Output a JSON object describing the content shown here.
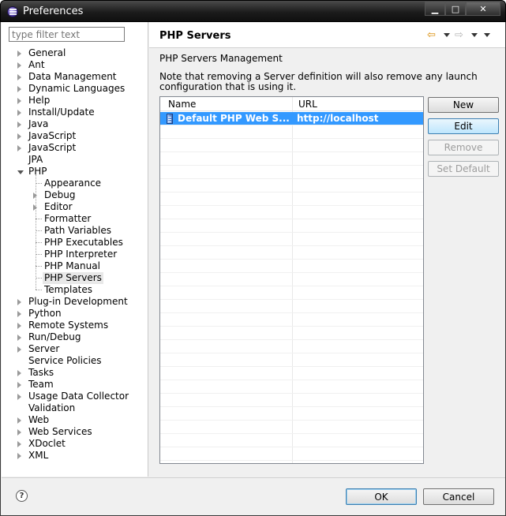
{
  "window": {
    "title": "Preferences",
    "controls": {
      "minimize": "▁",
      "maximize": "□",
      "close": "✕"
    }
  },
  "sidebar": {
    "filter": {
      "value": "",
      "placeholder": "type filter text"
    },
    "items": [
      {
        "label": "General",
        "expandable": true,
        "level": 0
      },
      {
        "label": "Ant",
        "expandable": true,
        "level": 0
      },
      {
        "label": "Data Management",
        "expandable": true,
        "level": 0
      },
      {
        "label": "Dynamic Languages",
        "expandable": true,
        "level": 0
      },
      {
        "label": "Help",
        "expandable": true,
        "level": 0
      },
      {
        "label": "Install/Update",
        "expandable": true,
        "level": 0
      },
      {
        "label": "Java",
        "expandable": true,
        "level": 0
      },
      {
        "label": "JavaScript",
        "expandable": true,
        "level": 0
      },
      {
        "label": "JavaScript",
        "expandable": true,
        "level": 0
      },
      {
        "label": "JPA",
        "expandable": false,
        "level": 0
      },
      {
        "label": "PHP",
        "expandable": true,
        "expanded": true,
        "level": 0
      },
      {
        "label": "Appearance",
        "expandable": false,
        "level": 1
      },
      {
        "label": "Debug",
        "expandable": true,
        "level": 1
      },
      {
        "label": "Editor",
        "expandable": true,
        "level": 1
      },
      {
        "label": "Formatter",
        "expandable": false,
        "level": 1
      },
      {
        "label": "Path Variables",
        "expandable": false,
        "level": 1
      },
      {
        "label": "PHP Executables",
        "expandable": false,
        "level": 1
      },
      {
        "label": "PHP Interpreter",
        "expandable": false,
        "level": 1
      },
      {
        "label": "PHP Manual",
        "expandable": false,
        "level": 1
      },
      {
        "label": "PHP Servers",
        "expandable": false,
        "level": 1,
        "selected": true
      },
      {
        "label": "Templates",
        "expandable": false,
        "level": 1
      },
      {
        "label": "Plug-in Development",
        "expandable": true,
        "level": 0
      },
      {
        "label": "Python",
        "expandable": true,
        "level": 0
      },
      {
        "label": "Remote Systems",
        "expandable": true,
        "level": 0
      },
      {
        "label": "Run/Debug",
        "expandable": true,
        "level": 0
      },
      {
        "label": "Server",
        "expandable": true,
        "level": 0
      },
      {
        "label": "Service Policies",
        "expandable": false,
        "level": 0
      },
      {
        "label": "Tasks",
        "expandable": true,
        "level": 0
      },
      {
        "label": "Team",
        "expandable": true,
        "level": 0
      },
      {
        "label": "Usage Data Collector",
        "expandable": true,
        "level": 0
      },
      {
        "label": "Validation",
        "expandable": false,
        "level": 0
      },
      {
        "label": "Web",
        "expandable": true,
        "level": 0
      },
      {
        "label": "Web Services",
        "expandable": true,
        "level": 0
      },
      {
        "label": "XDoclet",
        "expandable": true,
        "level": 0
      },
      {
        "label": "XML",
        "expandable": true,
        "level": 0
      }
    ]
  },
  "page": {
    "title": "PHP Servers",
    "section_title": "PHP Servers Management",
    "note": "Note that removing a Server definition will also remove any launch configuration that is using it.",
    "nav": {
      "back_icon": "⇦",
      "forward_icon": "⇨"
    },
    "table": {
      "columns": [
        "Name",
        "URL"
      ],
      "rows": [
        {
          "name": "Default PHP Web S...",
          "url": "http://localhost",
          "selected": true
        }
      ],
      "empty_rows": 25
    },
    "buttons": {
      "new": "New",
      "edit": "Edit",
      "remove": "Remove",
      "set_default": "Set Default"
    }
  },
  "footer": {
    "help_icon": "?",
    "ok": "OK",
    "cancel": "Cancel"
  }
}
